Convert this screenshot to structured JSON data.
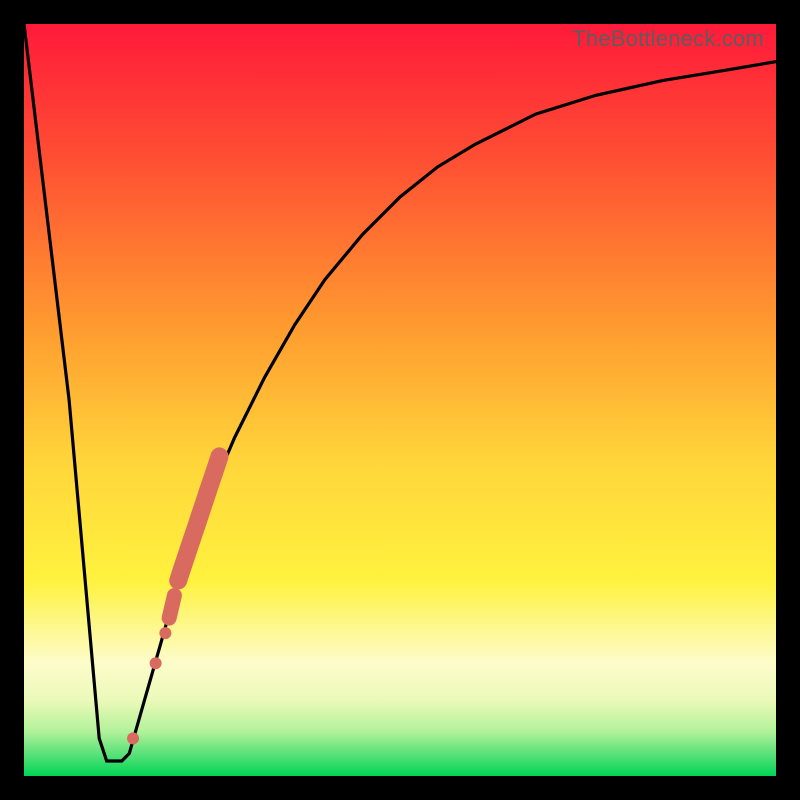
{
  "watermark": "TheBottleneck.com",
  "colors": {
    "gradient_top": "#ff1a3a",
    "gradient_mid_upper": "#ff8a2a",
    "gradient_mid": "#ffe83a",
    "gradient_lower_band": "#fdfccb",
    "gradient_green_1": "#c9f7b0",
    "gradient_green_2": "#5ce27a",
    "gradient_bottom": "#00d455",
    "curve": "#000000",
    "marker": "#d96a5f"
  },
  "chart_data": {
    "type": "line",
    "title": "",
    "xlabel": "",
    "ylabel": "",
    "xlim": [
      0,
      100
    ],
    "ylim": [
      0,
      100
    ],
    "grid": false,
    "legend": false,
    "series": [
      {
        "name": "bottleneck-curve",
        "x": [
          0,
          6,
          10,
          11,
          12,
          13,
          14,
          16,
          18,
          20,
          22,
          25,
          28,
          32,
          36,
          40,
          45,
          50,
          55,
          60,
          68,
          76,
          85,
          93,
          100
        ],
        "y": [
          100,
          50,
          5,
          2,
          2,
          2,
          3,
          10,
          17,
          24,
          30,
          38,
          45,
          53,
          60,
          66,
          72,
          77,
          81,
          84,
          88,
          90.5,
          92.5,
          93.8,
          95
        ]
      },
      {
        "name": "highlight-segments",
        "type": "scatter",
        "x": [
          14.5,
          17.5,
          18.8,
          19.3,
          20,
          20.5,
          21,
          21.5,
          22,
          22.5,
          23,
          23.5,
          24,
          24.5,
          25,
          25.5,
          26
        ],
        "y": [
          5,
          15,
          19,
          21,
          24,
          26,
          27.5,
          29,
          30.5,
          32,
          33.5,
          35,
          36.5,
          38,
          39.5,
          41,
          42.5
        ]
      }
    ],
    "annotations": []
  }
}
